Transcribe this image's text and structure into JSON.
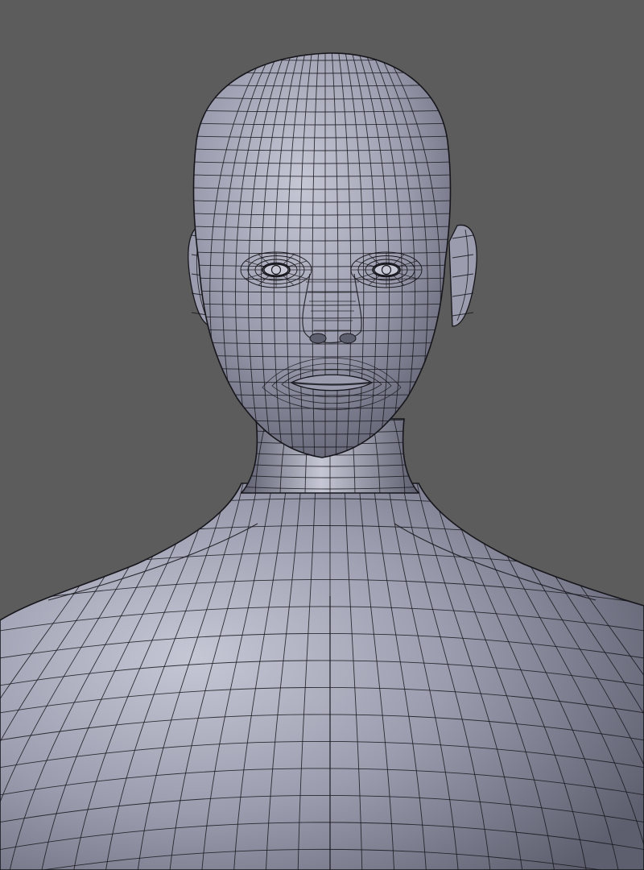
{
  "viewport": {
    "background_color": "#5c5c5c",
    "mesh_fill_color": "#9b9cae",
    "mesh_highlight_color": "#c6c7d5",
    "mesh_shadow_color": "#5d5e6e",
    "wireframe_color": "#16161c"
  },
  "model": {
    "icon": "human-figure-mesh-icon",
    "shading": "solid-with-wireframe"
  }
}
